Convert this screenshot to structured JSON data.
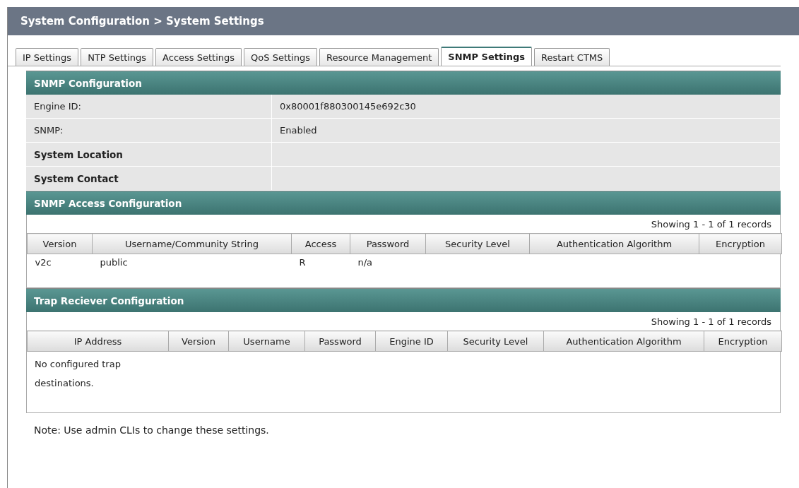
{
  "title": "System Configuration > System Settings",
  "tabs": [
    {
      "label": "IP Settings",
      "selected": false
    },
    {
      "label": "NTP Settings",
      "selected": false
    },
    {
      "label": "Access Settings",
      "selected": false
    },
    {
      "label": "QoS Settings",
      "selected": false
    },
    {
      "label": "Resource Management",
      "selected": false
    },
    {
      "label": "SNMP Settings",
      "selected": true
    },
    {
      "label": "Restart CTMS",
      "selected": false
    }
  ],
  "snmp_configuration": {
    "title": "SNMP Configuration",
    "rows": [
      {
        "label": "Engine ID:",
        "value": "0x80001f880300145e692c30",
        "kind": "plain"
      },
      {
        "label": "SNMP:",
        "value": "Enabled",
        "kind": "plain"
      },
      {
        "label": "System Location",
        "kind": "strong"
      },
      {
        "label": "System Contact",
        "kind": "strong"
      }
    ]
  },
  "access_configuration": {
    "title": "SNMP Access Configuration",
    "records": "Showing 1 - 1 of 1 records",
    "columns": [
      "Version",
      "Username/Community String",
      "Access",
      "Password",
      "Security Level",
      "Authentication Algorithm",
      "Encryption"
    ],
    "rows": [
      [
        "v2c",
        "public",
        "R",
        "n/a"
      ]
    ]
  },
  "trap_configuration": {
    "title": "Trap Reciever Configuration",
    "records": "Showing 1 - 1 of 1 records",
    "columns": [
      "IP Address",
      "Version",
      "Username",
      "Password",
      "Engine ID",
      "Security Level",
      "Authentication Algorithm",
      "Encryption"
    ],
    "empty_message": "No configured trap destinations."
  },
  "note": "Note: Use admin CLIs to change these settings."
}
